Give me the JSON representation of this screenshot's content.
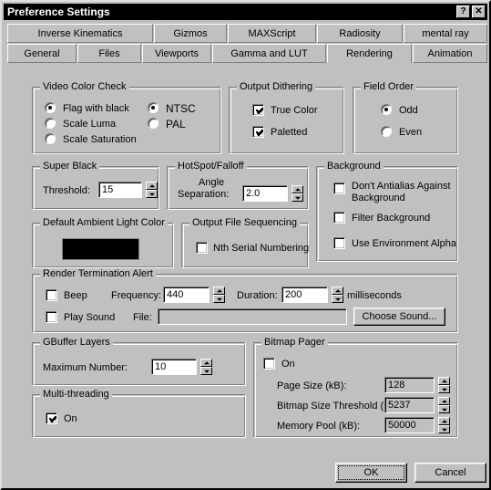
{
  "window": {
    "title": "Preference Settings",
    "help_button": "?",
    "close_button": "✕"
  },
  "tabs": {
    "row1": [
      {
        "label": "Inverse Kinematics",
        "selected": false
      },
      {
        "label": "Gizmos",
        "selected": false
      },
      {
        "label": "MAXScript",
        "selected": false
      },
      {
        "label": "Radiosity",
        "selected": false
      },
      {
        "label": "mental ray",
        "selected": false
      }
    ],
    "row2": [
      {
        "label": "General",
        "selected": false
      },
      {
        "label": "Files",
        "selected": false
      },
      {
        "label": "Viewports",
        "selected": false
      },
      {
        "label": "Gamma and LUT",
        "selected": false
      },
      {
        "label": "Rendering",
        "selected": true
      },
      {
        "label": "Animation",
        "selected": false
      }
    ]
  },
  "video_color_check": {
    "title": "Video Color Check",
    "method_options": [
      "Flag with black",
      "Scale Luma",
      "Scale Saturation"
    ],
    "method_selected": "Flag with black",
    "standard_options": [
      "NTSC",
      "PAL"
    ],
    "standard_selected": "NTSC"
  },
  "output_dithering": {
    "title": "Output Dithering",
    "items": [
      {
        "label": "True Color",
        "checked": true
      },
      {
        "label": "Paletted",
        "checked": true
      }
    ]
  },
  "field_order": {
    "title": "Field Order",
    "options": [
      "Odd",
      "Even"
    ],
    "selected": "Odd"
  },
  "super_black": {
    "title": "Super Black",
    "threshold_label": "Threshold:",
    "threshold_value": "15"
  },
  "hotspot_falloff": {
    "title": "HotSpot/Falloff",
    "angle_label_line1": "Angle",
    "angle_label_line2": "Separation:",
    "angle_value": "2.0"
  },
  "background": {
    "title": "Background",
    "items": [
      {
        "label": "Don't Antialias Against Background",
        "checked": false
      },
      {
        "label": "Filter Background",
        "checked": false
      },
      {
        "label": "Use Environment Alpha",
        "checked": false
      }
    ]
  },
  "ambient_light": {
    "title": "Default Ambient Light Color",
    "swatch_color": "#000000"
  },
  "output_file_sequencing": {
    "title": "Output File Sequencing",
    "nth_label": "Nth Serial Numbering",
    "nth_checked": false
  },
  "render_alert": {
    "title": "Render Termination Alert",
    "beep_label": "Beep",
    "beep_checked": false,
    "frequency_label": "Frequency:",
    "frequency_value": "440",
    "duration_label": "Duration:",
    "duration_value": "200",
    "milliseconds_label": "milliseconds",
    "play_sound_label": "Play Sound",
    "play_sound_checked": false,
    "file_label": "File:",
    "file_value": "",
    "choose_sound_label": "Choose Sound..."
  },
  "gbuffer": {
    "title": "GBuffer Layers",
    "max_label": "Maximum Number:",
    "max_value": "10"
  },
  "multithreading": {
    "title": "Multi-threading",
    "on_label": "On",
    "on_checked": true
  },
  "bitmap_pager": {
    "title": "Bitmap Pager",
    "on_label": "On",
    "on_checked": false,
    "rows": [
      {
        "label": "Page Size (kB):",
        "value": "128"
      },
      {
        "label": "Bitmap Size Threshold (kB):",
        "value": "5237"
      },
      {
        "label": "Memory Pool (kB):",
        "value": "50000"
      }
    ]
  },
  "footer": {
    "ok_label": "OK",
    "cancel_label": "Cancel"
  },
  "colors": {
    "face": "#c0c0c0",
    "titlebar": "#000000",
    "title_text": "#ffffff",
    "shadow": "#808080",
    "highlight": "#ffffff"
  }
}
